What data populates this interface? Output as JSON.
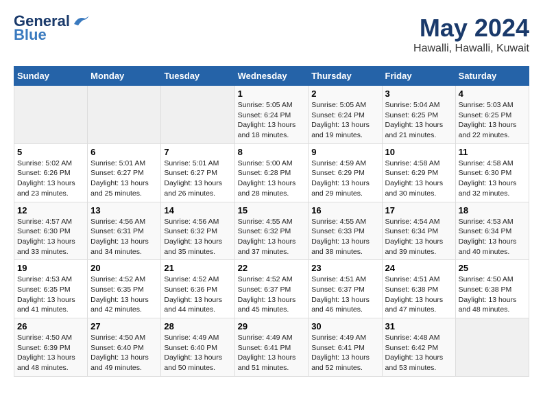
{
  "header": {
    "logo_line1": "General",
    "logo_line2": "Blue",
    "month_title": "May 2024",
    "location": "Hawalli, Hawalli, Kuwait"
  },
  "days_of_week": [
    "Sunday",
    "Monday",
    "Tuesday",
    "Wednesday",
    "Thursday",
    "Friday",
    "Saturday"
  ],
  "weeks": [
    [
      {
        "day": "",
        "info": ""
      },
      {
        "day": "",
        "info": ""
      },
      {
        "day": "",
        "info": ""
      },
      {
        "day": "1",
        "info": "Sunrise: 5:05 AM\nSunset: 6:24 PM\nDaylight: 13 hours\nand 18 minutes."
      },
      {
        "day": "2",
        "info": "Sunrise: 5:05 AM\nSunset: 6:24 PM\nDaylight: 13 hours\nand 19 minutes."
      },
      {
        "day": "3",
        "info": "Sunrise: 5:04 AM\nSunset: 6:25 PM\nDaylight: 13 hours\nand 21 minutes."
      },
      {
        "day": "4",
        "info": "Sunrise: 5:03 AM\nSunset: 6:25 PM\nDaylight: 13 hours\nand 22 minutes."
      }
    ],
    [
      {
        "day": "5",
        "info": "Sunrise: 5:02 AM\nSunset: 6:26 PM\nDaylight: 13 hours\nand 23 minutes."
      },
      {
        "day": "6",
        "info": "Sunrise: 5:01 AM\nSunset: 6:27 PM\nDaylight: 13 hours\nand 25 minutes."
      },
      {
        "day": "7",
        "info": "Sunrise: 5:01 AM\nSunset: 6:27 PM\nDaylight: 13 hours\nand 26 minutes."
      },
      {
        "day": "8",
        "info": "Sunrise: 5:00 AM\nSunset: 6:28 PM\nDaylight: 13 hours\nand 28 minutes."
      },
      {
        "day": "9",
        "info": "Sunrise: 4:59 AM\nSunset: 6:29 PM\nDaylight: 13 hours\nand 29 minutes."
      },
      {
        "day": "10",
        "info": "Sunrise: 4:58 AM\nSunset: 6:29 PM\nDaylight: 13 hours\nand 30 minutes."
      },
      {
        "day": "11",
        "info": "Sunrise: 4:58 AM\nSunset: 6:30 PM\nDaylight: 13 hours\nand 32 minutes."
      }
    ],
    [
      {
        "day": "12",
        "info": "Sunrise: 4:57 AM\nSunset: 6:30 PM\nDaylight: 13 hours\nand 33 minutes."
      },
      {
        "day": "13",
        "info": "Sunrise: 4:56 AM\nSunset: 6:31 PM\nDaylight: 13 hours\nand 34 minutes."
      },
      {
        "day": "14",
        "info": "Sunrise: 4:56 AM\nSunset: 6:32 PM\nDaylight: 13 hours\nand 35 minutes."
      },
      {
        "day": "15",
        "info": "Sunrise: 4:55 AM\nSunset: 6:32 PM\nDaylight: 13 hours\nand 37 minutes."
      },
      {
        "day": "16",
        "info": "Sunrise: 4:55 AM\nSunset: 6:33 PM\nDaylight: 13 hours\nand 38 minutes."
      },
      {
        "day": "17",
        "info": "Sunrise: 4:54 AM\nSunset: 6:34 PM\nDaylight: 13 hours\nand 39 minutes."
      },
      {
        "day": "18",
        "info": "Sunrise: 4:53 AM\nSunset: 6:34 PM\nDaylight: 13 hours\nand 40 minutes."
      }
    ],
    [
      {
        "day": "19",
        "info": "Sunrise: 4:53 AM\nSunset: 6:35 PM\nDaylight: 13 hours\nand 41 minutes."
      },
      {
        "day": "20",
        "info": "Sunrise: 4:52 AM\nSunset: 6:35 PM\nDaylight: 13 hours\nand 42 minutes."
      },
      {
        "day": "21",
        "info": "Sunrise: 4:52 AM\nSunset: 6:36 PM\nDaylight: 13 hours\nand 44 minutes."
      },
      {
        "day": "22",
        "info": "Sunrise: 4:52 AM\nSunset: 6:37 PM\nDaylight: 13 hours\nand 45 minutes."
      },
      {
        "day": "23",
        "info": "Sunrise: 4:51 AM\nSunset: 6:37 PM\nDaylight: 13 hours\nand 46 minutes."
      },
      {
        "day": "24",
        "info": "Sunrise: 4:51 AM\nSunset: 6:38 PM\nDaylight: 13 hours\nand 47 minutes."
      },
      {
        "day": "25",
        "info": "Sunrise: 4:50 AM\nSunset: 6:38 PM\nDaylight: 13 hours\nand 48 minutes."
      }
    ],
    [
      {
        "day": "26",
        "info": "Sunrise: 4:50 AM\nSunset: 6:39 PM\nDaylight: 13 hours\nand 48 minutes."
      },
      {
        "day": "27",
        "info": "Sunrise: 4:50 AM\nSunset: 6:40 PM\nDaylight: 13 hours\nand 49 minutes."
      },
      {
        "day": "28",
        "info": "Sunrise: 4:49 AM\nSunset: 6:40 PM\nDaylight: 13 hours\nand 50 minutes."
      },
      {
        "day": "29",
        "info": "Sunrise: 4:49 AM\nSunset: 6:41 PM\nDaylight: 13 hours\nand 51 minutes."
      },
      {
        "day": "30",
        "info": "Sunrise: 4:49 AM\nSunset: 6:41 PM\nDaylight: 13 hours\nand 52 minutes."
      },
      {
        "day": "31",
        "info": "Sunrise: 4:48 AM\nSunset: 6:42 PM\nDaylight: 13 hours\nand 53 minutes."
      },
      {
        "day": "",
        "info": ""
      }
    ]
  ]
}
